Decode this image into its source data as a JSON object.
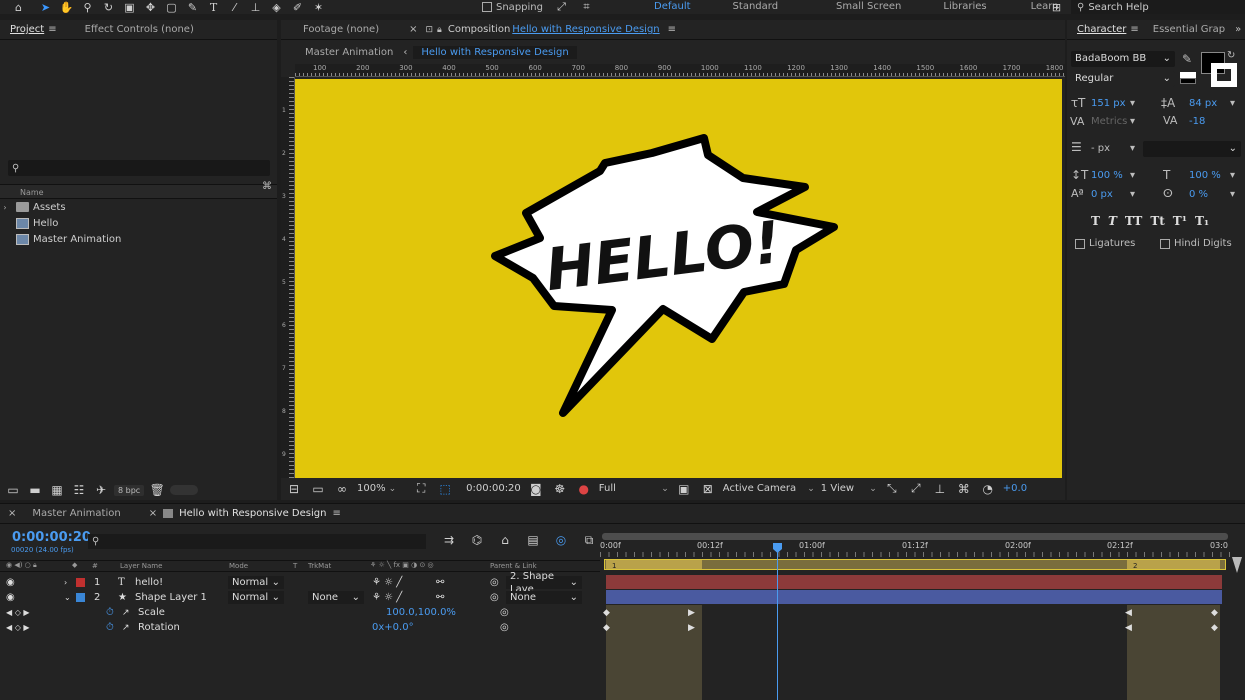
{
  "toolbar": {
    "snapping_label": "Snapping",
    "workspaces": [
      "Default",
      "Standard",
      "Small Screen",
      "Libraries",
      "Learn"
    ],
    "search_help": "Search Help"
  },
  "project_panel": {
    "tabs": [
      "Project",
      "Effect Controls (none)"
    ],
    "search_placeholder": "",
    "column_name": "Name",
    "items": [
      {
        "label": "Assets",
        "type": "folder"
      },
      {
        "label": "Hello",
        "type": "comp"
      },
      {
        "label": "Master Animation",
        "type": "comp"
      }
    ],
    "bpc": "8 bpc"
  },
  "comp_panel": {
    "tab_footage": "Footage (none)",
    "tab_comp_prefix": "Composition",
    "tab_comp_name": "Hello with Responsive Design",
    "nav": [
      "Master Animation",
      "Hello with Responsive Design"
    ],
    "ruler_labels": [
      "100",
      "200",
      "300",
      "400",
      "500",
      "600",
      "700",
      "800",
      "900",
      "1000",
      "1100",
      "1200",
      "1300",
      "1400",
      "1500",
      "1600",
      "1700",
      "1800"
    ],
    "ruler_left_labels": [
      "1",
      "2",
      "3",
      "4",
      "5",
      "6",
      "7",
      "8",
      "9"
    ],
    "bubble_text": "HELLO!",
    "zoom": "100%",
    "timecode": "0:00:00:20",
    "resolution": "Full",
    "camera": "Active Camera",
    "views": "1 View",
    "exposure": "+0.0",
    "canvas_color": "#e1c60b"
  },
  "character": {
    "tabs": [
      "Character",
      "Essential Grap"
    ],
    "font": "BadaBoom BB",
    "style": "Regular",
    "font_size": "151 px",
    "leading": "84 px",
    "kerning": "Metrics",
    "tracking": "-18",
    "stroke_width": "- px",
    "vscale": "100 %",
    "hscale": "100 %",
    "baseline": "0 px",
    "tsume": "0 %",
    "styles": [
      "T",
      "T",
      "TT",
      "Tt",
      "T¹",
      "T₁"
    ],
    "ligatures": "Ligatures",
    "hindi_digits": "Hindi Digits"
  },
  "timeline": {
    "tabs": [
      "Master Animation",
      "Hello with Responsive Design"
    ],
    "timecode": "0:00:00:20",
    "frame_info": "00020 (24.00 fps)",
    "headers": {
      "num": "#",
      "layer_name": "Layer Name",
      "mode": "Mode",
      "t": "T",
      "trkmat": "TrkMat",
      "parent": "Parent & Link"
    },
    "layers": [
      {
        "num": "1",
        "name": "hello!",
        "mode": "Normal",
        "trkmat": "",
        "parent": "2. Shape Laye",
        "color": "#c0302f",
        "icon": "T"
      },
      {
        "num": "2",
        "name": "Shape Layer 1",
        "mode": "Normal",
        "trkmat": "None",
        "parent": "None",
        "color": "#3a86d6",
        "icon": "★"
      }
    ],
    "props": [
      {
        "name": "Scale",
        "value": "100.0,100.0%"
      },
      {
        "name": "Rotation",
        "value": "0x+0.0°"
      }
    ],
    "ruler": [
      "0:00f",
      "00:12f",
      "01:00f",
      "01:12f",
      "02:00f",
      "02:12f",
      "03:0"
    ],
    "markers": [
      "1",
      "2"
    ]
  }
}
